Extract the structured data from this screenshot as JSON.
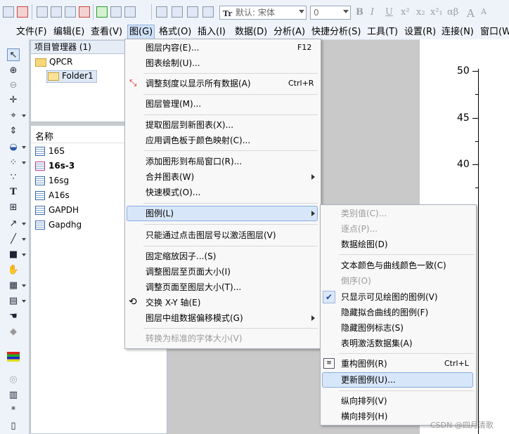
{
  "toolbar": {
    "font_name": "默认: 宋体",
    "font_size": "0",
    "format_buttons": [
      "B",
      "I",
      "U",
      "x²",
      "x₂",
      "x²₁",
      "αβ",
      "A",
      "A"
    ]
  },
  "menubar": {
    "items": [
      {
        "label": "文件(F)"
      },
      {
        "label": "编辑(E)"
      },
      {
        "label": "查看(V)"
      },
      {
        "label": "图(G)"
      },
      {
        "label": "格式(O)"
      },
      {
        "label": "插入(I)"
      },
      {
        "label": "数据(D)"
      },
      {
        "label": "分析(A)"
      },
      {
        "label": "快捷分析(S)"
      },
      {
        "label": "工具(T)"
      },
      {
        "label": "设置(R)"
      },
      {
        "label": "连接(N)"
      },
      {
        "label": "窗口(W)"
      }
    ]
  },
  "project_manager": {
    "title": "项目管理器 (1)",
    "root": "QPCR",
    "folder": "Folder1",
    "column_header": "名称",
    "items": [
      {
        "label": "16S",
        "bold": false
      },
      {
        "label": "16s-3",
        "bold": true
      },
      {
        "label": "16sg",
        "bold": false
      },
      {
        "label": "A16s",
        "bold": false
      },
      {
        "label": "GAPDH",
        "bold": false
      },
      {
        "label": "Gapdhg",
        "bold": false
      }
    ]
  },
  "graph": {
    "y_ticks": [
      "50",
      "45",
      "40"
    ]
  },
  "graph_menu": {
    "items": [
      {
        "label": "图层内容(E)...",
        "shortcut": "F12"
      },
      {
        "label": "图表绘制(U)..."
      },
      {
        "label": "调整刻度以显示所有数据(A)",
        "shortcut": "Ctrl+R"
      },
      {
        "label": "图层管理(M)..."
      },
      {
        "label": "提取图层到新图表(X)..."
      },
      {
        "label": "应用调色板于颜色映射(C)..."
      },
      {
        "label": "添加图形到布局窗口(R)..."
      },
      {
        "label": "合并图表(W)"
      },
      {
        "label": "快速模式(O)..."
      },
      {
        "label": "图例(L)"
      },
      {
        "label": "只能通过点击图层号以激活图层(V)"
      },
      {
        "label": "固定缩放因子...(S)"
      },
      {
        "label": "调整图层至页面大小(I)"
      },
      {
        "label": "调整页面至图层大小(T)..."
      },
      {
        "label": "交换 X-Y 轴(E)"
      },
      {
        "label": "图层中组数据偏移模式(G)"
      },
      {
        "label": "转换为标准的字体大小(V)",
        "disabled": true
      }
    ]
  },
  "legend_submenu": {
    "items": [
      {
        "label": "类别值(C)...",
        "disabled": true
      },
      {
        "label": "逐点(P)...",
        "disabled": true
      },
      {
        "label": "数据绘图(D)"
      },
      {
        "label": "文本颜色与曲线颜色一致(C)"
      },
      {
        "label": "倒序(O)",
        "disabled": true
      },
      {
        "label": "只显示可见绘图的图例(V)",
        "checked": true
      },
      {
        "label": "隐藏拟合曲线的图例(F)"
      },
      {
        "label": "隐藏图例标志(S)"
      },
      {
        "label": "表明激活数据集(A)"
      },
      {
        "label": "重构图例(R)",
        "shortcut": "Ctrl+L"
      },
      {
        "label": "更新图例(U)..."
      },
      {
        "label": "纵向排列(V)"
      },
      {
        "label": "横向排列(H)"
      }
    ]
  },
  "watermark": "CSDN @四月清歌"
}
